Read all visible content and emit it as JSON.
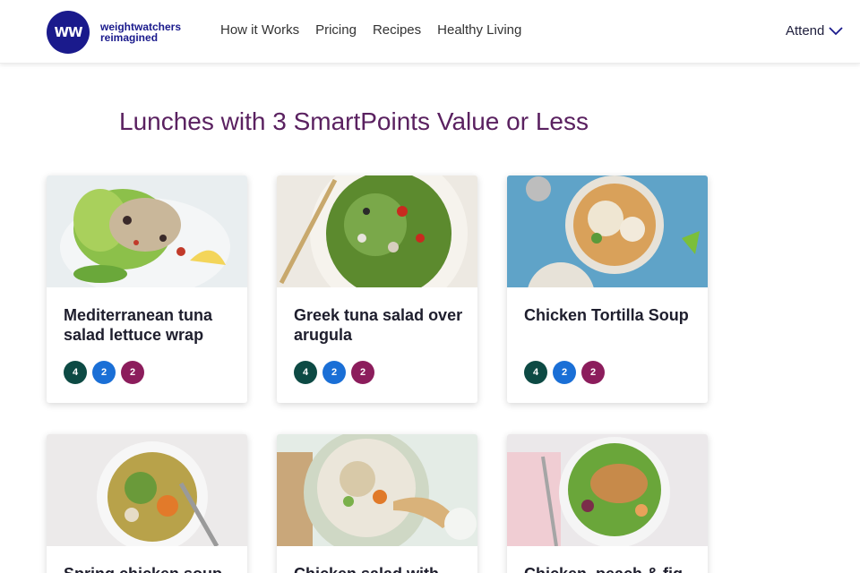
{
  "brand": {
    "logo_letters": "WW",
    "logo_text": "weightwatchers reimagined"
  },
  "nav": {
    "items": [
      "How it Works",
      "Pricing",
      "Recipes",
      "Healthy Living"
    ],
    "attend_label": "Attend"
  },
  "page": {
    "title": "Lunches with 3 SmartPoints Value or Less"
  },
  "recipes": [
    {
      "name": "Mediterranean tuna salad lettuce wrap",
      "points": [
        "4",
        "2",
        "2"
      ]
    },
    {
      "name": "Greek tuna salad over arugula",
      "points": [
        "4",
        "2",
        "2"
      ]
    },
    {
      "name": "Chicken Tortilla Soup",
      "points": [
        "4",
        "2",
        "2"
      ]
    },
    {
      "name": "Spring chicken soup",
      "points": []
    },
    {
      "name": "Chicken salad with",
      "points": []
    },
    {
      "name": "Chicken, peach & fig",
      "points": []
    }
  ],
  "colors": {
    "brand_navy": "#1a1a8c",
    "title_purple": "#5a2160",
    "points_green": "#0d4a44",
    "points_blue": "#1a6fd6",
    "points_purple": "#8c1d5c"
  },
  "icons": {
    "attend_chevron": "chevron-down-icon"
  }
}
